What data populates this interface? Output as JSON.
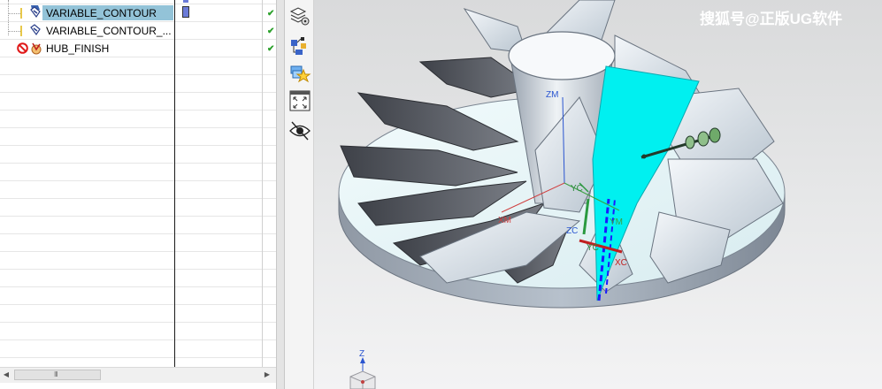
{
  "navigator": {
    "rows": [
      {
        "label": "VARIABLE_CONTOUR",
        "selected": true,
        "status_icon": "check-icon"
      },
      {
        "label": "VARIABLE_CONTOUR_...",
        "selected": false,
        "status_icon": "check-icon"
      },
      {
        "label": "HUB_FINISH",
        "selected": false,
        "status_icon": "check-icon"
      }
    ],
    "scrollbar_grip": "III"
  },
  "resource_bar": {
    "icons": [
      "assembly-navigator-icon",
      "part-navigator-icon",
      "reuse-library-icon",
      "fit-view-icon",
      "visibility-eye-icon"
    ]
  },
  "viewport": {
    "watermark": "搜狐号@正版UG软件",
    "axis_labels": {
      "zm": "ZM",
      "xm": "XM",
      "ym": "YM",
      "yc": "YC",
      "zc": "ZC",
      "xc": "XC",
      "yc2": "YC"
    },
    "triad_label": "Z",
    "colors": {
      "highlight_blade": "#00f0f0",
      "model_body": "#c9d3dc",
      "hub_top": "#e4f3f6",
      "blade_dark": "#5d6068",
      "tool_path": "#1a1aff"
    }
  }
}
